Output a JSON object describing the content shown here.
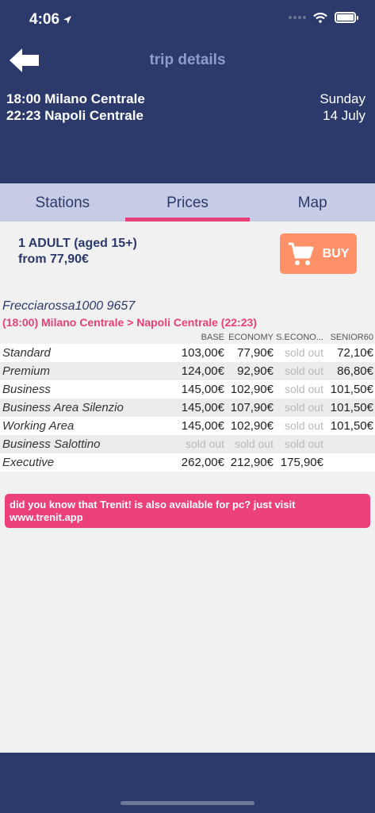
{
  "status_bar": {
    "time": "4:06"
  },
  "header": {
    "title": "trip details",
    "departure": {
      "time": "18:00",
      "station": "Milano Centrale"
    },
    "arrival": {
      "time": "22:23",
      "station": "Napoli Centrale"
    },
    "day": "Sunday",
    "date": "14 July"
  },
  "tabs": [
    {
      "label": "Stations"
    },
    {
      "label": "Prices"
    },
    {
      "label": "Map"
    }
  ],
  "fare": {
    "passengers": "1 ADULT (aged 15+)",
    "from_price": "from 77,90€",
    "buy_label": "BUY"
  },
  "train": {
    "name": "Frecciarossa1000 9657",
    "route": "(18:00) Milano Centrale > Napoli Centrale (22:23)"
  },
  "columns": [
    "BASE",
    "ECONOMY",
    "S.ECONO...",
    "SENIOR60"
  ],
  "rows": [
    {
      "class": "Standard",
      "prices": [
        "103,00€",
        "77,90€",
        "sold out",
        "72,10€"
      ]
    },
    {
      "class": "Premium",
      "prices": [
        "124,00€",
        "92,90€",
        "sold out",
        "86,80€"
      ]
    },
    {
      "class": "Business",
      "prices": [
        "145,00€",
        "102,90€",
        "sold out",
        "101,50€"
      ]
    },
    {
      "class": "Business Area Silenzio",
      "prices": [
        "145,00€",
        "107,90€",
        "sold out",
        "101,50€"
      ]
    },
    {
      "class": "Working Area",
      "prices": [
        "145,00€",
        "102,90€",
        "sold out",
        "101,50€"
      ]
    },
    {
      "class": "Business Salottino",
      "prices": [
        "sold out",
        "sold out",
        "sold out",
        ""
      ]
    },
    {
      "class": "Executive",
      "prices": [
        "262,00€",
        "212,90€",
        "175,90€",
        ""
      ]
    }
  ],
  "banner": {
    "text": "did you know that Trenit! is also available for pc? just visit www.trenit.app"
  },
  "colors": {
    "navy": "#2b3a6b",
    "accent_pink": "#e8407a",
    "buy_orange": "#ff9068",
    "tab_bar": "#c7cbe5"
  }
}
